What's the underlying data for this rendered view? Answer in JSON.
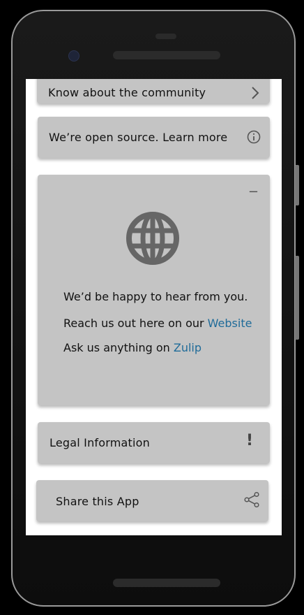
{
  "cards": {
    "community": {
      "label": "Know about the community",
      "icon": "chevron-right-icon"
    },
    "open_source": {
      "label": "We’re open source. Learn more",
      "icon": "info-icon"
    },
    "contact": {
      "icon": "globe-icon",
      "collapse_symbol": "−",
      "line1": "We’d be happy to hear from you.",
      "line2_prefix": "Reach us out here on our ",
      "line2_link": "Website",
      "line3_prefix": "Ask us anything on ",
      "line3_link": "Zulip"
    },
    "legal": {
      "label": "Legal Information",
      "icon_glyph": "!"
    },
    "share": {
      "label": "Share this App",
      "icon": "share-icon"
    }
  },
  "colors": {
    "card_bg": "#c4c4c4",
    "link": "#1f6b99",
    "screen_bg": "#ffffff",
    "device": "#111111"
  }
}
